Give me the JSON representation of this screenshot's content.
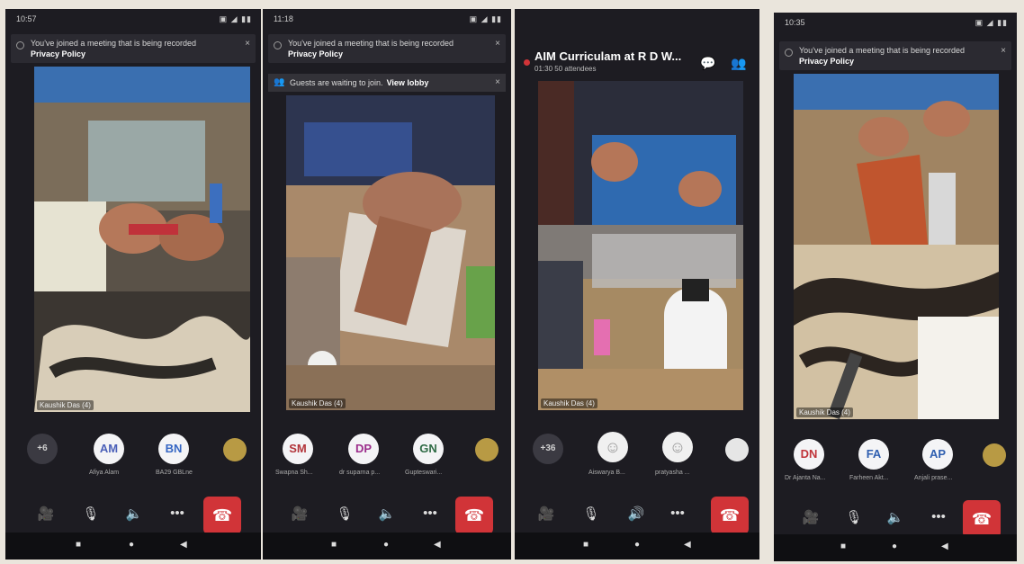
{
  "phones": [
    {
      "status": {
        "time": "10:57",
        "icons": "▣ ◢ ▮▮"
      },
      "banner": {
        "text": "You've joined a meeting that is being recorded",
        "link": "Privacy Policy",
        "close": "×"
      },
      "video_label": "Kaushik Das (4)",
      "avatars": [
        {
          "initials": "+6",
          "name": ""
        },
        {
          "initials": "AM",
          "name": "Afiya Alam"
        },
        {
          "initials": "BN",
          "name": "BA29 GBLne"
        },
        {
          "initials": "",
          "name": ""
        }
      ],
      "controls": [
        "🎥",
        "🎙",
        "🔈",
        "•••",
        "☎"
      ],
      "nav": [
        "■",
        "●",
        "◀"
      ]
    },
    {
      "status": {
        "time": "11:18",
        "icons": "▣ ◢ ▮▮"
      },
      "banner": {
        "text": "You've joined a meeting that is being recorded",
        "link": "Privacy Policy",
        "close": "×"
      },
      "banner2": {
        "text": "Guests are waiting to join.",
        "link": "View lobby",
        "close": "×"
      },
      "video_label": "Kaushik Das (4)",
      "avatars": [
        {
          "initials": "SM",
          "name": "Swapna Sh..."
        },
        {
          "initials": "DP",
          "name": "dr suparna p..."
        },
        {
          "initials": "GN",
          "name": "Gupteswari..."
        },
        {
          "initials": "",
          "name": ""
        }
      ],
      "controls": [
        "🎥",
        "🎙",
        "🔈",
        "•••",
        "☎"
      ],
      "nav": [
        "■",
        "●",
        "◀"
      ]
    },
    {
      "header": {
        "title": "AIM Curriculam at R D W...",
        "subtitle": "01:30  50 attendees"
      },
      "video_label": "Kaushik Das (4)",
      "avatars": [
        {
          "initials": "+36",
          "name": ""
        },
        {
          "initials": "",
          "name": "Aiswarya B..."
        },
        {
          "initials": "",
          "name": "pratyasha ..."
        },
        {
          "initials": "",
          "name": ""
        }
      ],
      "controls": [
        "🎥",
        "🎙",
        "🔊",
        "•••",
        "☎"
      ],
      "nav": [
        "■",
        "●",
        "◀"
      ]
    },
    {
      "status": {
        "time": "10:35",
        "icons": "▣ ◢ ▮▮"
      },
      "banner": {
        "text": "You've joined a meeting that is being recorded",
        "link": "Privacy Policy",
        "close": "×"
      },
      "video_label": "Kaushik Das (4)",
      "avatars": [
        {
          "initials": "DN",
          "name": "Dr Ajanta Na..."
        },
        {
          "initials": "FA",
          "name": "Farheen Akt..."
        },
        {
          "initials": "AP",
          "name": "Anjali prase..."
        },
        {
          "initials": "",
          "name": ""
        }
      ],
      "controls": [
        "🎥",
        "🎙",
        "🔈",
        "•••",
        "☎"
      ],
      "nav": [
        "■",
        "●",
        "◀"
      ]
    }
  ]
}
